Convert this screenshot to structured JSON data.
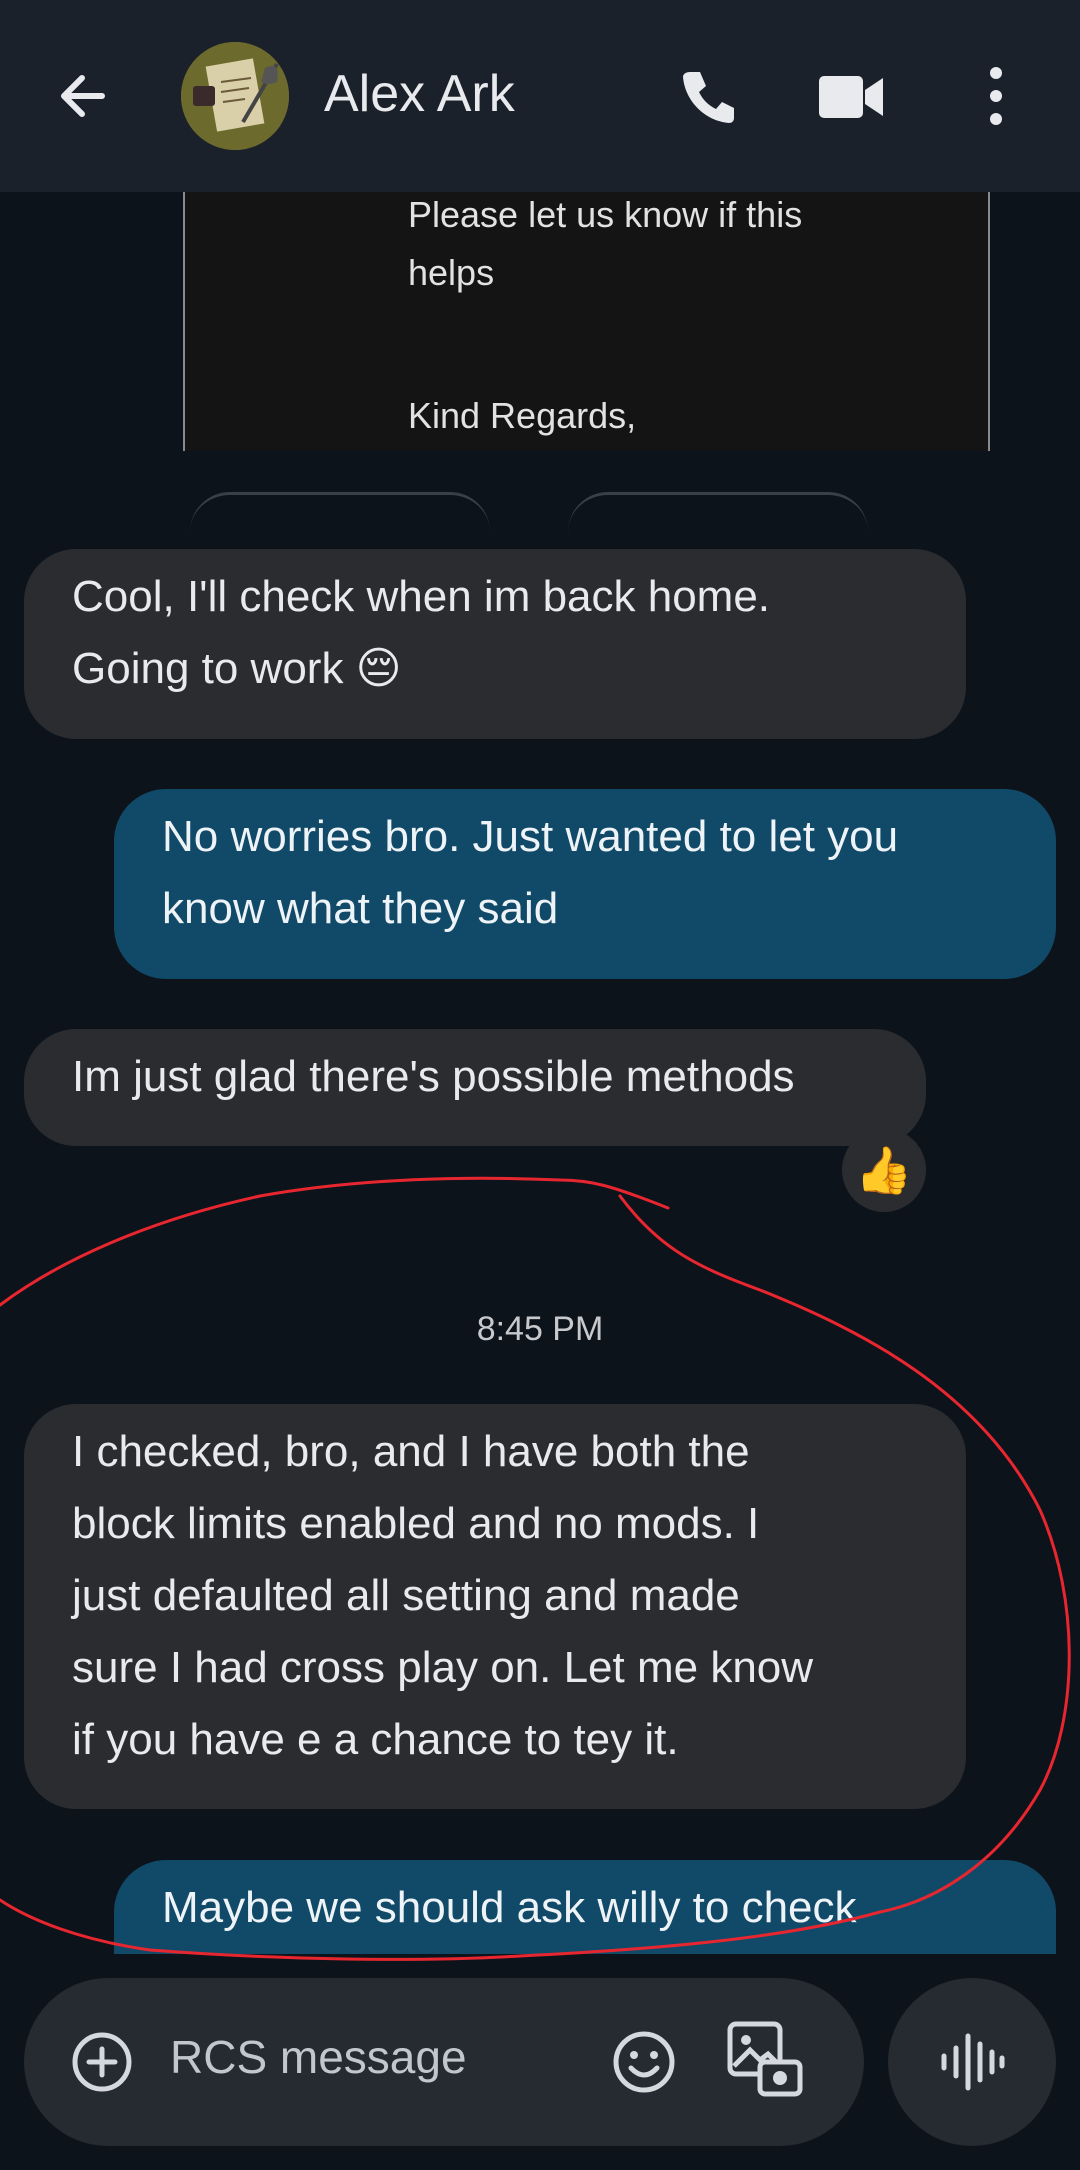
{
  "header": {
    "contact_name": "Alex Ark",
    "back_icon": "arrow-back-icon",
    "call_icon": "phone-icon",
    "video_icon": "videocam-icon",
    "more_icon": "more-vert-icon"
  },
  "email_excerpt": {
    "lines": [
      "Please let us know if this",
      "helps",
      "Kind Regards,"
    ]
  },
  "messages": [
    {
      "direction": "incoming",
      "lines": [
        "Cool, I'll check when im back home.",
        "Going to work 😔"
      ]
    },
    {
      "direction": "outgoing",
      "lines": [
        "No worries bro. Just wanted to let you",
        "know what they said"
      ]
    },
    {
      "direction": "incoming",
      "lines": [
        "Im just glad there's possible methods"
      ],
      "reaction": "👍"
    },
    {
      "direction": "incoming",
      "lines": [
        "I checked, bro, and I have both the",
        "block limits enabled and no mods. I",
        "just defaulted all setting and made",
        "sure I had cross play on. Let me know",
        "if you have e a chance to tey it."
      ]
    },
    {
      "direction": "outgoing",
      "lines": [
        "Maybe we should ask willy to check"
      ]
    }
  ],
  "timestamp": "8:45 PM",
  "composer": {
    "placeholder": "RCS message",
    "add_icon": "add-circle-icon",
    "emoji_icon": "emoji-icon",
    "gallery_icon": "gallery-icon",
    "voice_icon": "voice-waveform-icon"
  },
  "colors": {
    "background": "#0d131b",
    "incoming_bubble": "#2a2c30",
    "outgoing_bubble": "#114a68",
    "annotation": "#e8262f"
  }
}
